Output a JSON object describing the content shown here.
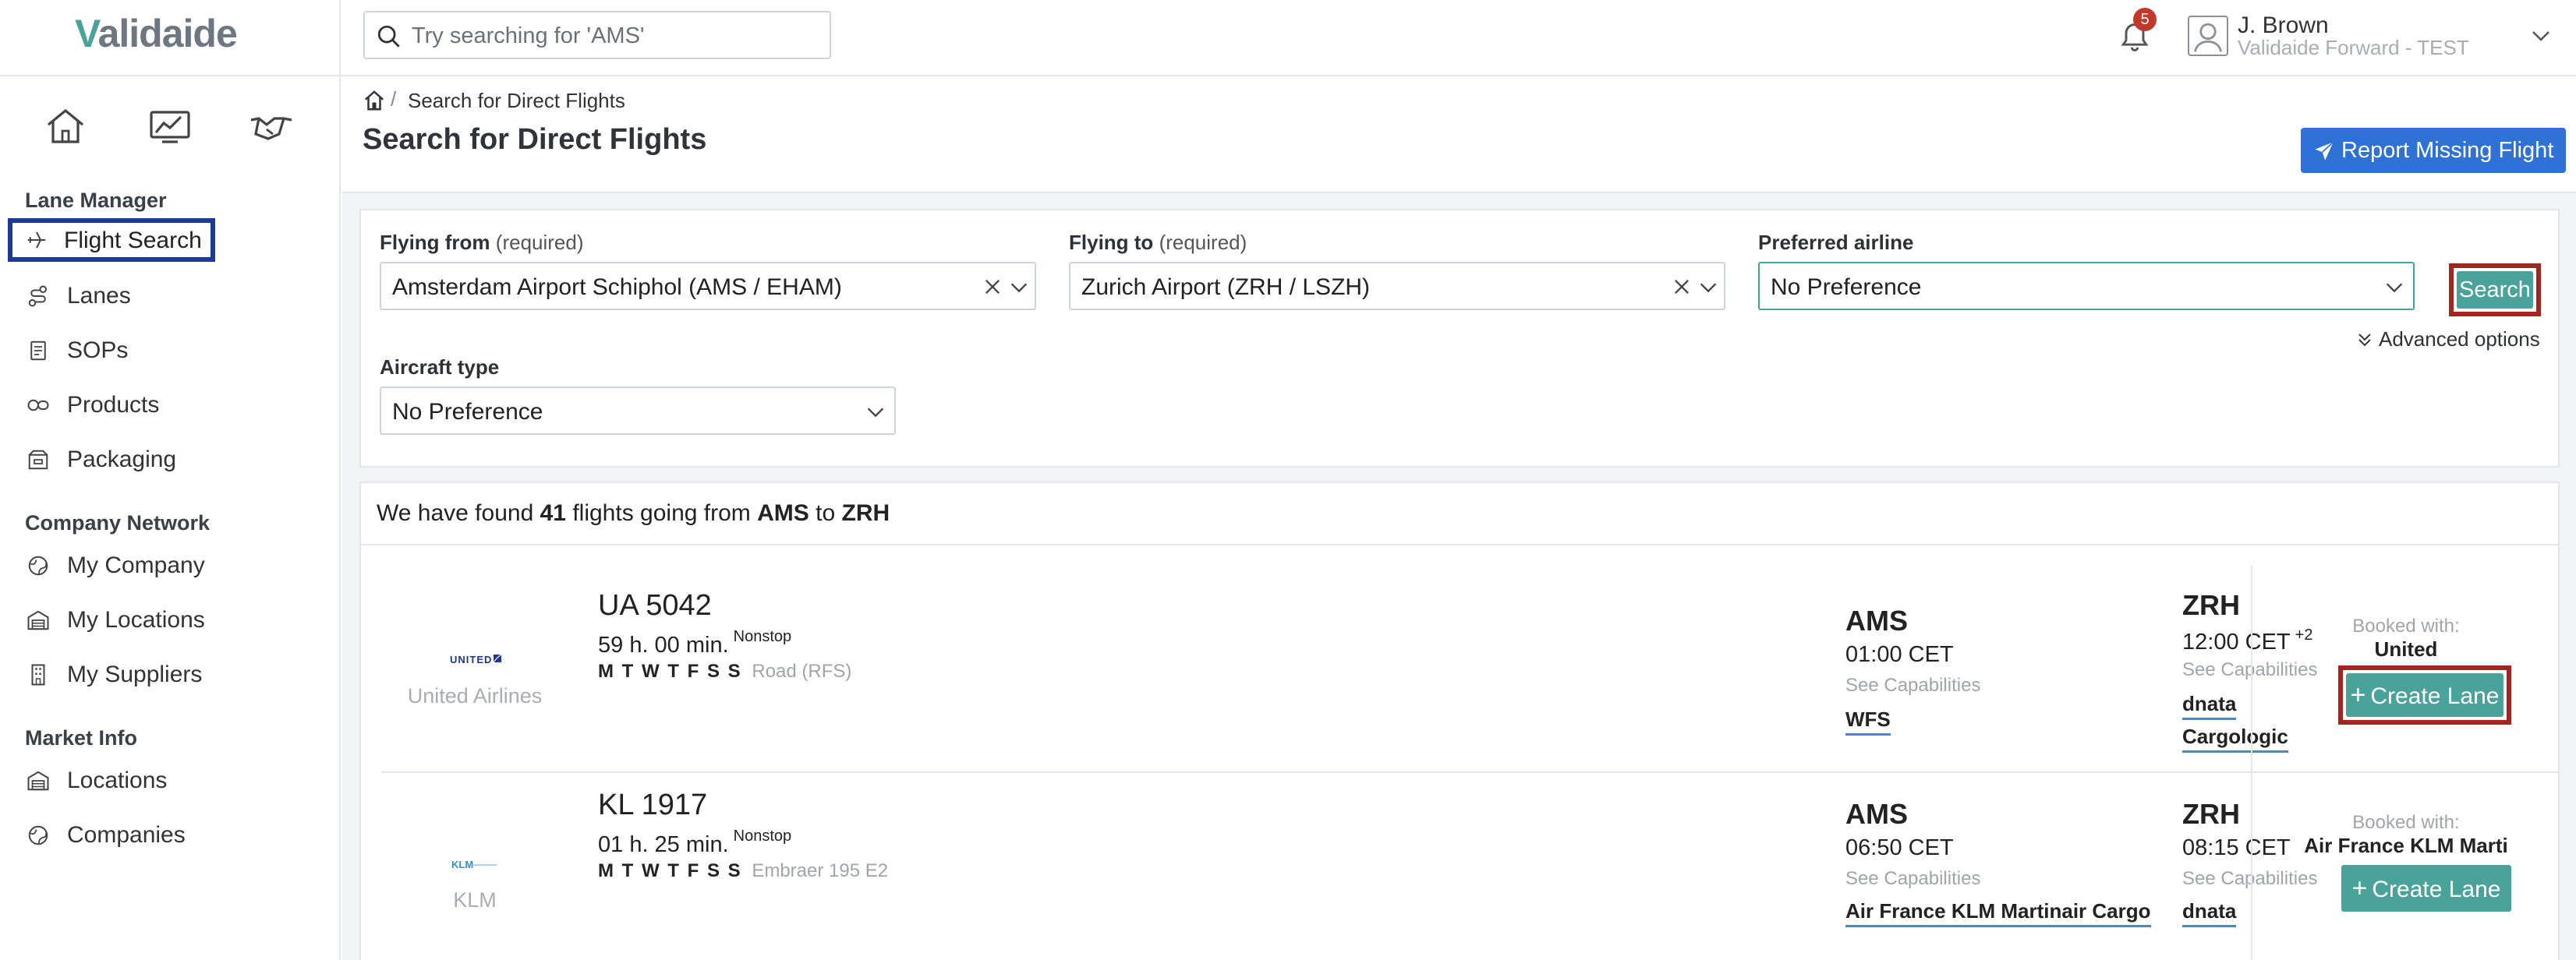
{
  "app": {
    "logo_prefix": "V",
    "logo_rest": "alidaide"
  },
  "search": {
    "placeholder": "Try searching for 'AMS'"
  },
  "notifications": {
    "count": "5"
  },
  "user": {
    "name": "J. Brown",
    "organization": "Validaide Forward - TEST"
  },
  "sidebar": {
    "top_icons": [
      "home-icon",
      "analytics-icon",
      "handshake-icon"
    ],
    "sections": [
      {
        "title": "Lane Manager",
        "items": [
          {
            "label": "Flight Search",
            "icon": "plane-icon",
            "active": true
          },
          {
            "label": "Lanes",
            "icon": "route-icon"
          },
          {
            "label": "SOPs",
            "icon": "document-icon"
          },
          {
            "label": "Products",
            "icon": "pills-icon"
          },
          {
            "label": "Packaging",
            "icon": "package-icon"
          }
        ]
      },
      {
        "title": "Company Network",
        "items": [
          {
            "label": "My Company",
            "icon": "globe-icon"
          },
          {
            "label": "My Locations",
            "icon": "warehouse-icon"
          },
          {
            "label": "My Suppliers",
            "icon": "building-icon"
          }
        ]
      },
      {
        "title": "Market Info",
        "items": [
          {
            "label": "Locations",
            "icon": "warehouse-icon"
          },
          {
            "label": "Companies",
            "icon": "globe-icon"
          }
        ]
      }
    ]
  },
  "breadcrumb": {
    "separator": "/",
    "current": "Search for Direct Flights"
  },
  "page": {
    "title": "Search for Direct Flights",
    "report_button": "Report Missing Flight"
  },
  "filters": {
    "from": {
      "label": "Flying from",
      "hint": "(required)",
      "value": "Amsterdam Airport Schiphol (AMS / EHAM)"
    },
    "to": {
      "label": "Flying to",
      "hint": "(required)",
      "value": "Zurich Airport (ZRH / LSZH)"
    },
    "airline": {
      "label": "Preferred airline",
      "value": "No Preference"
    },
    "aircraft": {
      "label": "Aircraft type",
      "value": "No Preference"
    },
    "search_button": "Search",
    "advanced_options": "Advanced options"
  },
  "results": {
    "summary_prefix": "We have found",
    "count": "41",
    "summary_mid": "flights going from",
    "origin": "AMS",
    "summary_to": "to",
    "destination": "ZRH",
    "flights": [
      {
        "airline": "United Airlines",
        "logo_text": "UNITED",
        "flight_number": "UA 5042",
        "duration": "59 h. 00 min.",
        "stops": "Nonstop",
        "days": "M T W T F S S",
        "equipment": "Road (RFS)",
        "dep_code": "AMS",
        "dep_time": "01:00 CET",
        "dep_caps": "See Capabilities",
        "dep_handlers": [
          "WFS"
        ],
        "arr_code": "ZRH",
        "arr_time": "12:00 CET",
        "arr_offset": "+2",
        "arr_caps": "See Capabilities",
        "arr_handlers": [
          "dnata",
          "Cargologic"
        ],
        "booked_label": "Booked with:",
        "booked_with": "United",
        "create_button": "Create Lane"
      },
      {
        "airline": "KLM",
        "logo_text": "KLM",
        "flight_number": "KL 1917",
        "duration": "01 h. 25 min.",
        "stops": "Nonstop",
        "days": "M T W T F S S",
        "equipment": "Embraer 195 E2",
        "dep_code": "AMS",
        "dep_time": "06:50 CET",
        "dep_caps": "See Capabilities",
        "dep_handlers": [
          "Air France KLM Martinair Cargo"
        ],
        "arr_code": "ZRH",
        "arr_time": "08:15 CET",
        "arr_caps": "See Capabilities",
        "arr_handlers": [
          "dnata"
        ],
        "booked_label": "Booked with:",
        "booked_with": "Air France KLM Marti",
        "create_button": "Create Lane"
      }
    ]
  },
  "colors": {
    "accent_teal": "#4aa39a",
    "primary_blue": "#2f72d6",
    "highlight_red": "#a3251f",
    "highlight_navy": "#1c3a96",
    "badge_red": "#c0392b"
  }
}
